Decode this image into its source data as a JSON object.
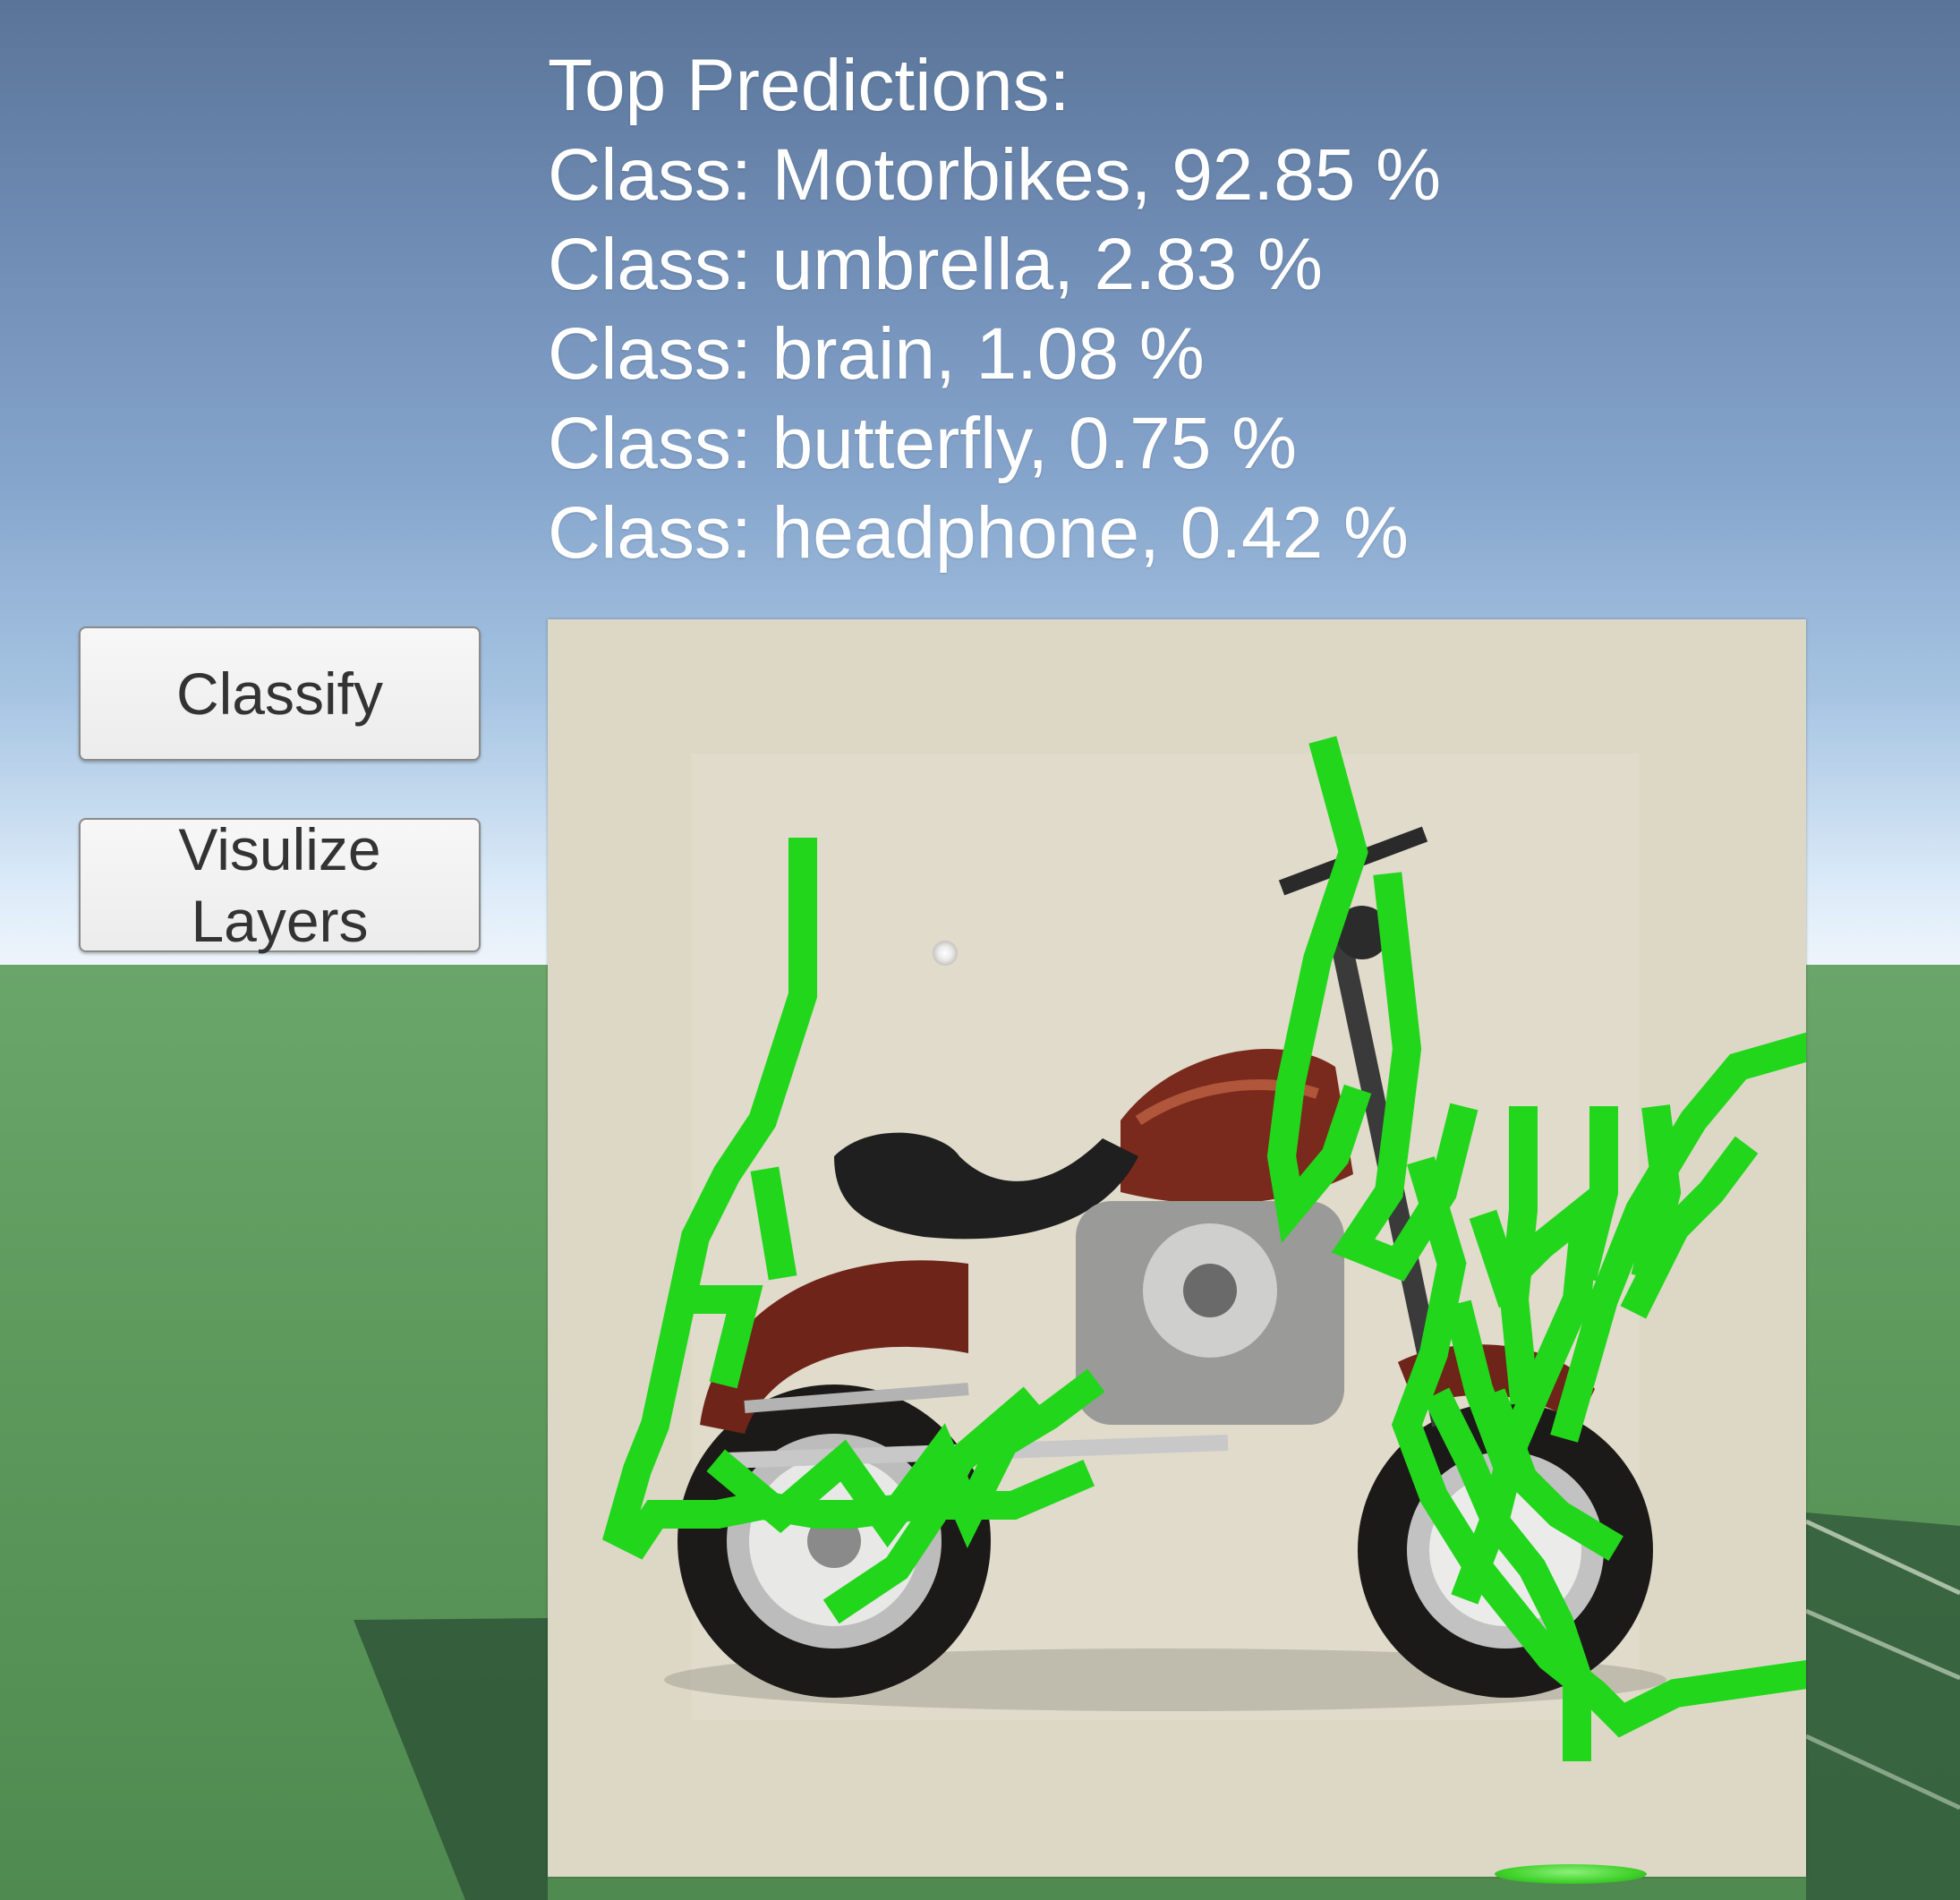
{
  "predictions": {
    "title": "Top Predictions:",
    "lines": [
      "Class: Motorbikes, 92.85 %",
      "Class: umbrella, 2.83 %",
      "Class: brain, 1.08 %",
      "Class: butterfly, 0.75 %",
      "Class: headphone, 0.42 %"
    ]
  },
  "buttons": {
    "classify_label": "Classify",
    "visualize_line1": "Visulize",
    "visualize_line2": "Layers"
  },
  "canvas": {
    "image_subject": "motorcycle-image",
    "stroke_color": "#22d61c"
  },
  "colors": {
    "sky_top": "#5a7498",
    "ground": "#5e9a5c",
    "panel_bg": "#ddd8c6"
  }
}
